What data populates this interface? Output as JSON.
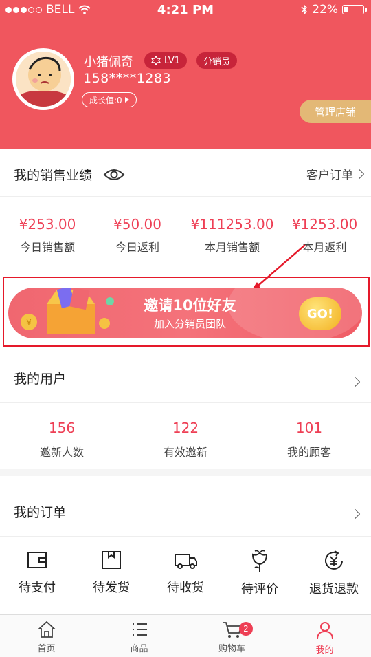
{
  "status_bar": {
    "carrier": "BELL",
    "time": "4:21 PM",
    "battery": "22%"
  },
  "profile": {
    "name": "小猪佩奇",
    "level": "LV1",
    "role": "分销员",
    "phone": "158****1283",
    "growth": "成长值:0",
    "manage_button": "管理店铺"
  },
  "sales": {
    "title": "我的销售业绩",
    "customer_orders": "客户订单",
    "stats": [
      {
        "value": "¥253.00",
        "label": "今日销售额"
      },
      {
        "value": "¥50.00",
        "label": "今日返利"
      },
      {
        "value": "¥111253.00",
        "label": "本月销售额"
      },
      {
        "value": "¥1253.00",
        "label": "本月返利"
      }
    ]
  },
  "invite": {
    "title": "邀请10位好友",
    "subtitle": "加入分销员团队",
    "button": "GO!"
  },
  "users": {
    "title": "我的用户",
    "stats": [
      {
        "value": "156",
        "label": "邀新人数"
      },
      {
        "value": "122",
        "label": "有效邀新"
      },
      {
        "value": "101",
        "label": "我的顾客"
      }
    ]
  },
  "orders": {
    "title": "我的订单",
    "items": [
      {
        "label": "待支付",
        "icon": "wallet-icon"
      },
      {
        "label": "待发货",
        "icon": "box-icon"
      },
      {
        "label": "待收货",
        "icon": "truck-icon"
      },
      {
        "label": "待评价",
        "icon": "flower-icon"
      },
      {
        "label": "退货退款",
        "icon": "refund-icon"
      }
    ]
  },
  "tabbar": {
    "items": [
      {
        "label": "首页",
        "icon": "home-icon"
      },
      {
        "label": "商品",
        "icon": "list-icon"
      },
      {
        "label": "购物车",
        "icon": "cart-icon",
        "badge": "2"
      },
      {
        "label": "我的",
        "icon": "user-icon",
        "active": true
      }
    ]
  },
  "colors": {
    "header": "#f0565e",
    "accent": "#ee3f55",
    "gold": "#e3b876"
  }
}
